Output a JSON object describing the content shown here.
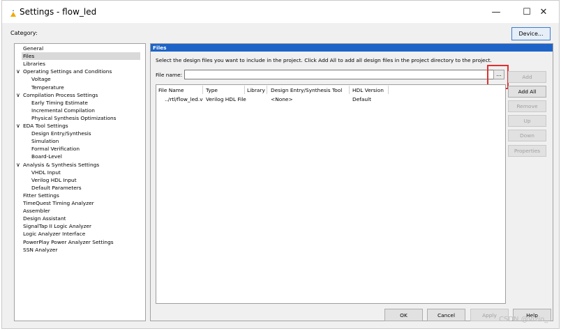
{
  "window": {
    "title": "Settings - flow_led",
    "minimize": "—",
    "maximize": "☐",
    "close": "✕"
  },
  "category_label": "Category:",
  "device_button": "Device...",
  "tree": {
    "items": [
      {
        "label": "General",
        "depth": 0,
        "expander": ""
      },
      {
        "label": "Files",
        "depth": 0,
        "expander": "",
        "selected": true
      },
      {
        "label": "Libraries",
        "depth": 0,
        "expander": ""
      },
      {
        "label": "Operating Settings and Conditions",
        "depth": 0,
        "expander": "∨"
      },
      {
        "label": "Voltage",
        "depth": 1,
        "expander": ""
      },
      {
        "label": "Temperature",
        "depth": 1,
        "expander": ""
      },
      {
        "label": "Compilation Process Settings",
        "depth": 0,
        "expander": "∨"
      },
      {
        "label": "Early Timing Estimate",
        "depth": 1,
        "expander": ""
      },
      {
        "label": "Incremental Compilation",
        "depth": 1,
        "expander": ""
      },
      {
        "label": "Physical Synthesis Optimizations",
        "depth": 1,
        "expander": ""
      },
      {
        "label": "EDA Tool Settings",
        "depth": 0,
        "expander": "∨"
      },
      {
        "label": "Design Entry/Synthesis",
        "depth": 1,
        "expander": ""
      },
      {
        "label": "Simulation",
        "depth": 1,
        "expander": ""
      },
      {
        "label": "Formal Verification",
        "depth": 1,
        "expander": ""
      },
      {
        "label": "Board-Level",
        "depth": 1,
        "expander": ""
      },
      {
        "label": "Analysis & Synthesis Settings",
        "depth": 0,
        "expander": "∨"
      },
      {
        "label": "VHDL Input",
        "depth": 1,
        "expander": ""
      },
      {
        "label": "Verilog HDL Input",
        "depth": 1,
        "expander": ""
      },
      {
        "label": "Default Parameters",
        "depth": 1,
        "expander": ""
      },
      {
        "label": "Fitter Settings",
        "depth": 0,
        "expander": ""
      },
      {
        "label": "TimeQuest Timing Analyzer",
        "depth": 0,
        "expander": ""
      },
      {
        "label": "Assembler",
        "depth": 0,
        "expander": ""
      },
      {
        "label": "Design Assistant",
        "depth": 0,
        "expander": ""
      },
      {
        "label": "SignalTap II Logic Analyzer",
        "depth": 0,
        "expander": ""
      },
      {
        "label": "Logic Analyzer Interface",
        "depth": 0,
        "expander": ""
      },
      {
        "label": "PowerPlay Power Analyzer Settings",
        "depth": 0,
        "expander": ""
      },
      {
        "label": "SSN Analyzer",
        "depth": 0,
        "expander": ""
      }
    ]
  },
  "panel": {
    "header": "Files",
    "description": "Select the design files you want to include in the project. Click Add All to add all design files in the project directory to the project.",
    "file_name_label": "File name:",
    "file_name_value": "",
    "browse_label": "...",
    "columns": [
      "File Name",
      "Type",
      "Library",
      "Design Entry/Synthesis Tool",
      "HDL Version"
    ],
    "rows": [
      {
        "file_name": "../rtl/flow_led.v",
        "type": "Verilog HDL File",
        "library": "",
        "tool": "<None>",
        "hdl_version": "Default"
      }
    ],
    "side_buttons": {
      "add": "Add",
      "add_all": "Add All",
      "remove": "Remove",
      "up": "Up",
      "down": "Down",
      "properties": "Properties"
    }
  },
  "bottom_buttons": {
    "ok": "OK",
    "cancel": "Cancel",
    "apply": "Apply",
    "help": "Help"
  },
  "watermark": "CSDN @Vizio_",
  "colors": {
    "panel_header": "#1e64c8",
    "highlight": "#e03030"
  }
}
